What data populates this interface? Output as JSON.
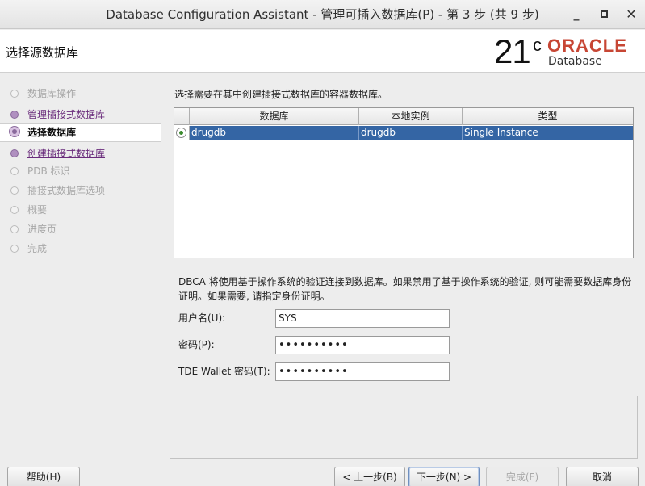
{
  "window": {
    "title": "Database Configuration Assistant - 管理可插入数据库(P) - 第 3 步 (共 9 步)",
    "min_glyph": "_",
    "close_glyph": "✕"
  },
  "header": {
    "step_title": "选择源数据库",
    "logo_version": "21",
    "logo_sup": "c",
    "logo_brand": "ORACLE",
    "logo_product": "Database"
  },
  "nav": {
    "items": [
      {
        "label": "数据库操作",
        "state": "pending"
      },
      {
        "label": "管理插接式数据库",
        "state": "done"
      },
      {
        "label": "选择数据库",
        "state": "current"
      },
      {
        "label": "创建插接式数据库",
        "state": "done"
      },
      {
        "label": "PDB 标识",
        "state": "pending"
      },
      {
        "label": "插接式数据库选项",
        "state": "pending"
      },
      {
        "label": "概要",
        "state": "pending"
      },
      {
        "label": "进度页",
        "state": "pending"
      },
      {
        "label": "完成",
        "state": "pending"
      }
    ]
  },
  "main": {
    "intro": "选择需要在其中创建插接式数据库的容器数据库。",
    "table": {
      "columns": [
        "数据库",
        "本地实例",
        "类型"
      ],
      "rows": [
        {
          "database": "drugdb",
          "instance": "drugdb",
          "type": "Single Instance",
          "selected": true
        }
      ]
    },
    "note": "DBCA 将使用基于操作系统的验证连接到数据库。如果禁用了基于操作系统的验证, 则可能需要数据库身份证明。如果需要, 请指定身份证明。",
    "username_label": "用户名(U):",
    "username_value": "SYS",
    "password_label": "密码(P):",
    "password_value": "••••••••••",
    "tde_label": "TDE Wallet 密码(T):",
    "tde_value": "••••••••••"
  },
  "buttons": {
    "help": "帮助(H)",
    "back": "< 上一步(B)",
    "next": "下一步(N) >",
    "finish": "完成(F)",
    "cancel": "取消"
  },
  "colors": {
    "selection": "#3465a4",
    "oracle_red": "#c74634",
    "nav_done": "#6a2c7c"
  }
}
